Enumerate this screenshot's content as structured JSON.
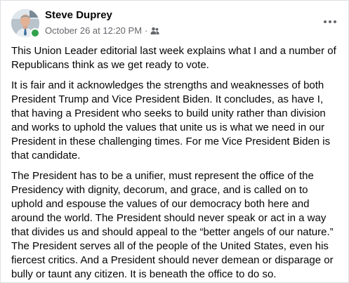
{
  "post": {
    "author": "Steve Duprey",
    "timestamp": "October 26 at 12:20 PM",
    "separator": "·",
    "audience_icon": "friends-icon",
    "more_icon": "more-options-icon",
    "online_color": "#31a24c",
    "paragraphs": [
      "This Union Leader editorial last week explains what I and a number of Republicans think as we get ready to vote.",
      "It is fair and it acknowledges the strengths and weaknesses of both President Trump and Vice President Biden. It concludes, as have I, that having a President who seeks to build unity rather than division and works to uphold the values that unite us is what we need in our President in these challenging times. For me Vice President Biden is that candidate.",
      "The President has to be a unifier, must represent the office of the Presidency with dignity, decorum, and grace, and is called on to uphold and espouse the values of our democracy both here and around the world. The President should never speak or act in a way that divides us and should appeal to the “better angels of our nature.” The President serves all of the people of the United States, even his fiercest critics. And a President should never demean or disparage or bully or taunt any citizen. It is beneath the office to do so."
    ]
  }
}
